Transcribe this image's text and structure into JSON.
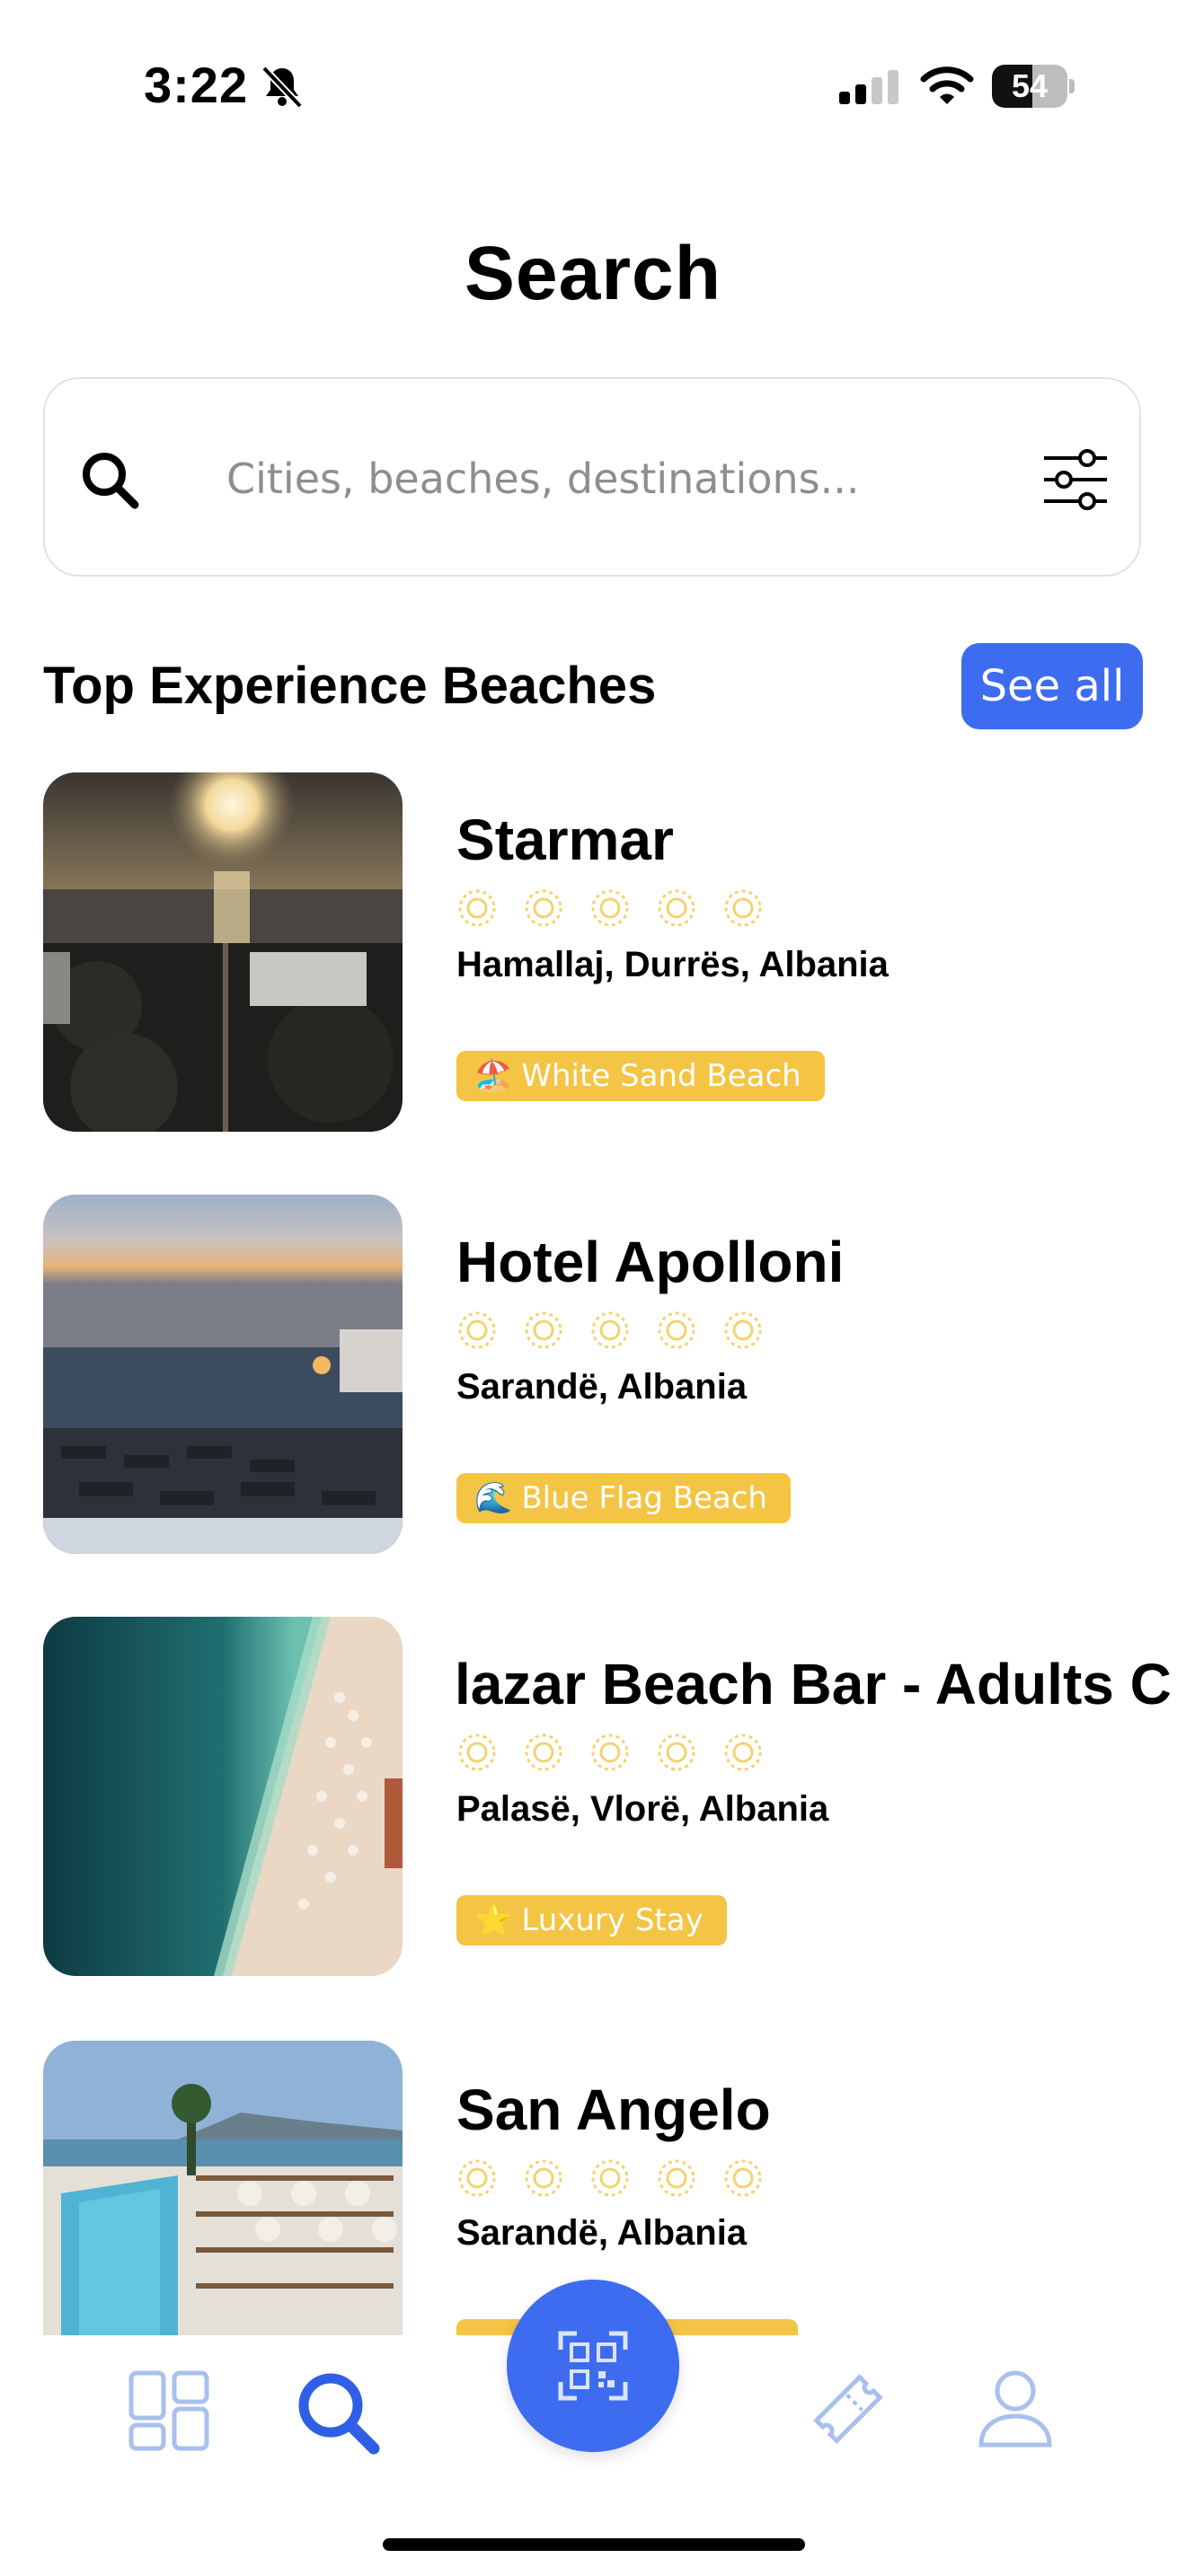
{
  "status_bar": {
    "time": "3:22",
    "battery": "54",
    "battery_level": 0.54
  },
  "page": {
    "title": "Search"
  },
  "search": {
    "placeholder": "Cities, beaches, destinations..."
  },
  "section": {
    "title": "Top Experience Beaches",
    "see_all_label": "See all"
  },
  "beaches": [
    {
      "name": "Starmar",
      "location": "Hamallaj, Durrës, Albania",
      "badge_emoji": "🏖️",
      "badge": "White Sand Beach",
      "rating": 5
    },
    {
      "name": "Hotel Apolloni",
      "location": "Sarandë, Albania",
      "badge_emoji": "🌊",
      "badge": "Blue Flag Beach",
      "rating": 5
    },
    {
      "name": "lazar Beach Bar - Adults C",
      "location": "Palasë, Vlorë, Albania",
      "badge_emoji": "⭐",
      "badge": "Luxury Stay",
      "rating": 5
    },
    {
      "name": "San Angelo",
      "location": "Sarandë, Albania",
      "badge_emoji": "",
      "badge": "",
      "rating": 5
    }
  ],
  "nav": {
    "items": [
      "dashboard-icon",
      "search-icon",
      "qr-scan-icon",
      "ticket-icon",
      "profile-icon"
    ],
    "active": "search-icon"
  },
  "colors": {
    "accent": "#3e6cf0",
    "badge": "#f4c444",
    "sun": "#f4d36e",
    "nav_inactive": "#a9c0ee"
  }
}
